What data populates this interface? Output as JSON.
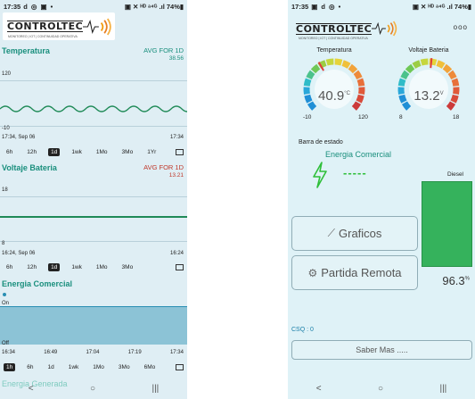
{
  "left": {
    "status": {
      "time": "17:35",
      "icons": "d ◎ ▣ •",
      "system": "▣ ✕ ᴴᴰ ᵃ⁴ᴳ .ıl 74%▮"
    },
    "logo": {
      "brand": "CONTROLTEC",
      "tagline": "MONITOREO | IOT | CONTINUIDAD OPERATIVA"
    },
    "temp_chart": {
      "title": "Temperatura",
      "avg_label": "AVG FOR 1D",
      "avg_value": "38.56",
      "y_top": "120",
      "y_bottom": "-10",
      "t_start": "17:34, Sep 06",
      "t_end": "17:34",
      "ranges": [
        "6h",
        "12h",
        "1d",
        "1wk",
        "1Mo",
        "3Mo",
        "1Yr"
      ],
      "selected": "1d"
    },
    "volt_chart": {
      "title": "Voltaje Bateria",
      "avg_label": "AVG FOR 1D",
      "avg_value": "13.21",
      "y_top": "18",
      "y_bottom": "8",
      "t_start": "16:24, Sep 06",
      "t_end": "16:24",
      "ranges": [
        "6h",
        "12h",
        "1d",
        "1wk",
        "1Mo",
        "3Mo"
      ],
      "selected": "1d"
    },
    "energy_chart": {
      "title": "Energia Comercial",
      "on": "On",
      "off": "Off",
      "times": [
        "16:34",
        "16:49",
        "17:04",
        "17:19",
        "17:34"
      ],
      "ranges": [
        "1h",
        "6h",
        "1d",
        "1wk",
        "1Mo",
        "3Mo",
        "6Mo"
      ],
      "selected": "1h",
      "next_title": "Energia Generada"
    },
    "nav": {
      "back": "<",
      "home": "○",
      "recent": "|||"
    },
    "colors": {
      "title": "#1a8f7d",
      "temp_avg": "#1a8f7d",
      "volt_avg": "#c0392b",
      "line": "#1f8a57"
    }
  },
  "right": {
    "status": {
      "time": "17:35",
      "icons": "▣ d ◎ •",
      "system": "▣ ✕ ᴴᴰ ᵃ⁴ᴳ .ıl 74%▮"
    },
    "logo": {
      "brand": "CONTROLTEC",
      "tagline": "MONITOREO | IOT | CONTINUIDAD OPERATIVA"
    },
    "more": "ooo",
    "temp_gauge": {
      "title": "Temperatura",
      "value": "40.9",
      "unit": "°C",
      "min": "-10",
      "max": "120",
      "level": 0.39
    },
    "volt_gauge": {
      "title": "Voltaje Bateria",
      "value": "13.2",
      "unit": "V",
      "min": "8",
      "max": "18",
      "level": 0.52
    },
    "estado_label": "Barra de estado",
    "energy_label": "Energia Comercial",
    "energy_status": "-----",
    "diesel": {
      "title": "Diesel",
      "value": "96.3",
      "unit": "%",
      "level": 0.963
    },
    "graficos_button": "Graficos",
    "partida_button": "Partida Remota",
    "csq": "CSQ : 0",
    "saber_button": "Saber Mas .....",
    "nav": {
      "back": "<",
      "home": "○",
      "recent": "|||"
    }
  }
}
